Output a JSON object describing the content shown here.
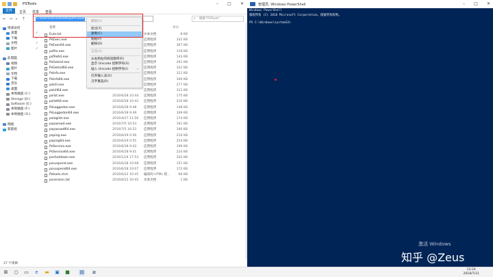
{
  "explorer": {
    "title": "PSTools",
    "ribbon_tabs": [
      "文件",
      "主页",
      "共享",
      "查看"
    ],
    "address_text": "C:\\Users\\zeus\\Desktop\\PSTools",
    "search_placeholder": "搜索\"PSTools\"",
    "header_name": "名称",
    "header_size": "大小",
    "status_text": "27 个项目",
    "sidebar": [
      {
        "label": "快速访问",
        "icon": "star-icon"
      },
      {
        "label": "桌面",
        "icon": "desktop-icon",
        "pinned": true
      },
      {
        "label": "下载",
        "icon": "download-icon",
        "pinned": true
      },
      {
        "label": "文档",
        "icon": "document-icon",
        "pinned": true
      },
      {
        "label": "图片",
        "icon": "picture-icon",
        "pinned": true
      },
      {
        "label": "",
        "icon": ""
      },
      {
        "label": "此电脑",
        "icon": "computer-icon"
      },
      {
        "label": "视频",
        "icon": "video-icon"
      },
      {
        "label": "图片",
        "icon": "picture-icon"
      },
      {
        "label": "文档",
        "icon": "document-icon"
      },
      {
        "label": "下载",
        "icon": "download-icon"
      },
      {
        "label": "音乐",
        "icon": "music-icon"
      },
      {
        "label": "桌面",
        "icon": "desktop-icon"
      },
      {
        "label": "本地磁盘 (C:)",
        "icon": "drive-icon"
      },
      {
        "label": "Storage (D:)",
        "icon": "drive-icon"
      },
      {
        "label": "Software (E:)",
        "icon": "drive-icon"
      },
      {
        "label": "本地磁盘 (F:)",
        "icon": "drive-icon"
      },
      {
        "label": "本地磁盘 (G:)",
        "icon": "drive-icon"
      },
      {
        "label": "",
        "icon": ""
      },
      {
        "label": "网络",
        "icon": "network-icon"
      },
      {
        "label": "家庭组",
        "icon": "homegroup-icon"
      }
    ],
    "files": [
      {
        "name": "Eula.txt",
        "date": "",
        "type": "文本文档",
        "size": "8 KB"
      },
      {
        "name": "PsExec.exe",
        "date": "",
        "type": "应用程序",
        "size": "332 KB"
      },
      {
        "name": "PsExec64.exe",
        "date": "",
        "type": "应用程序",
        "size": "367 KB"
      },
      {
        "name": "psfile.exe",
        "date": "",
        "type": "应用程序",
        "size": "118 KB"
      },
      {
        "name": "psfile64.exe",
        "date": "",
        "type": "应用程序",
        "size": "143 KB"
      },
      {
        "name": "PsGetsid.exe",
        "date": "",
        "type": "应用程序",
        "size": "291 KB"
      },
      {
        "name": "PsGetsid64.exe",
        "date": "",
        "type": "应用程序",
        "size": "322 KB"
      },
      {
        "name": "PsInfo.exe",
        "date": "",
        "type": "应用程序",
        "size": "311 KB"
      },
      {
        "name": "PsInfo64.exe",
        "date": "",
        "type": "应用程序",
        "size": "346 KB"
      },
      {
        "name": "pskill.exe",
        "date": "",
        "type": "应用程序",
        "size": "277 KB"
      },
      {
        "name": "pskill64.exe",
        "date": "",
        "type": "应用程序",
        "size": "311 KB"
      },
      {
        "name": "pslist.exe",
        "date": "2016/6/28 10:44",
        "type": "应用程序",
        "size": "175 KB"
      },
      {
        "name": "pslist64.exe",
        "date": "2016/6/28 10:42",
        "type": "应用程序",
        "size": "210 KB"
      },
      {
        "name": "PsLoggedon.exe",
        "date": "2016/6/28 9:48",
        "type": "应用程序",
        "size": "148 KB"
      },
      {
        "name": "PsLoggedon64.exe",
        "date": "2016/6/28 9:49",
        "type": "应用程序",
        "size": "169 KB"
      },
      {
        "name": "psloglist.exe",
        "date": "2016/4/27 11:56",
        "type": "应用程序",
        "size": "174 KB"
      },
      {
        "name": "pspasswd.exe",
        "date": "2016/7/5 16:53",
        "type": "应用程序",
        "size": "161 KB"
      },
      {
        "name": "pspasswd64.exe",
        "date": "2016/7/5 16:53",
        "type": "应用程序",
        "size": "190 KB"
      },
      {
        "name": "psping.exe",
        "date": "2016/6/29 0:56",
        "type": "应用程序",
        "size": "216 KB"
      },
      {
        "name": "psping64.exe",
        "date": "2016/6/29 0:55",
        "type": "应用程序",
        "size": "254 KB"
      },
      {
        "name": "PsService.exe",
        "date": "2016/6/28 9:43",
        "type": "应用程序",
        "size": "199 KB"
      },
      {
        "name": "PsService64.exe",
        "date": "2016/6/28 9:41",
        "type": "应用程序",
        "size": "224 KB"
      },
      {
        "name": "psshutdown.exe",
        "date": "2016/12/4 17:53",
        "type": "应用程序",
        "size": "202 KB"
      },
      {
        "name": "pssuspend.exe",
        "date": "2016/6/28 10:08",
        "type": "应用程序",
        "size": "151 KB"
      },
      {
        "name": "pssuspend64.exe",
        "date": "2016/6/28 10:07",
        "type": "应用程序",
        "size": "172 KB"
      },
      {
        "name": "Pstools.chm",
        "date": "2016/6/22 10:45",
        "type": "编译的 HTML 帮...",
        "size": "66 KB"
      },
      {
        "name": "psversion.txt",
        "date": "2016/6/22 10:45",
        "type": "文本文档",
        "size": "1 KB"
      }
    ]
  },
  "context_menu": [
    {
      "label": "撤销(U)",
      "disabled": true
    },
    {
      "sep": true
    },
    {
      "label": "剪切(T)"
    },
    {
      "label": "复制(C)",
      "highlighted": true
    },
    {
      "label": "粘贴(P)"
    },
    {
      "label": "删除(D)"
    },
    {
      "sep": true
    },
    {
      "label": "全选(A)",
      "disabled": true
    },
    {
      "sep": true
    },
    {
      "label": "从右到左的阅读顺序(R)"
    },
    {
      "label": "显示 Unicode 控制字符(S)"
    },
    {
      "label": "插入 Unicode 控制字符(I)",
      "submenu": true
    },
    {
      "sep": true
    },
    {
      "label": "打开输入法(O)"
    },
    {
      "label": "汉字重选(R)"
    }
  ],
  "powershell": {
    "title": "管理员: Windows PowerShell",
    "lines": [
      "Windows PowerShell",
      "版权所有 (C) 2016 Microsoft Corporation。保留所有权利。",
      "",
      "PS C:\\Windows\\system32>"
    ],
    "activate_text": "激活 Windows",
    "watermark": "知乎 @Zeus"
  },
  "taskbar": {
    "time": "13:24",
    "date": "2018/7/21",
    "icons": [
      "start-icon",
      "search-icon",
      "task-view-icon",
      "edge-icon",
      "explorer-icon",
      "store-icon",
      "app-icon",
      "powershell-icon"
    ]
  },
  "colors": {
    "ps_background": "#012456",
    "highlight_box": "#d8262b",
    "menu_highlight": "#91c9f7"
  }
}
